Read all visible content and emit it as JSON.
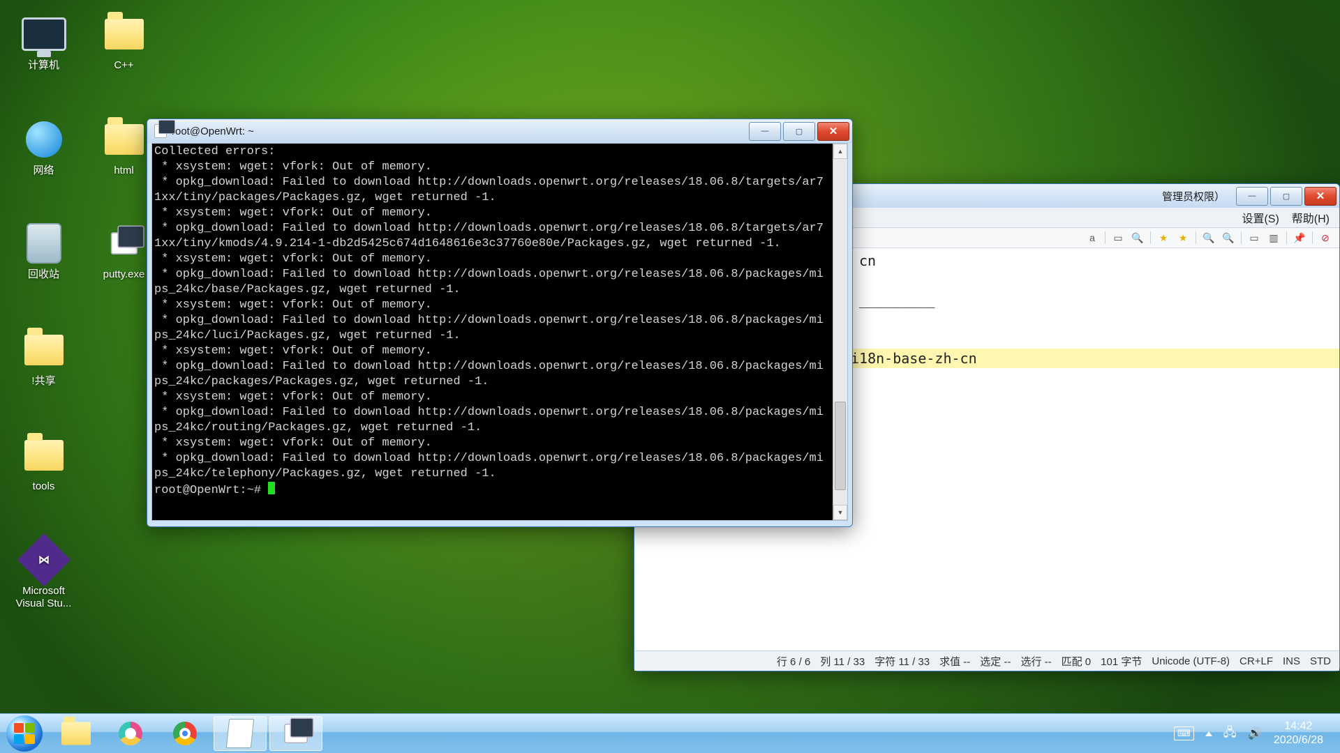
{
  "desktop_icons": {
    "computer": "计算机",
    "cpp": "C++",
    "network": "网络",
    "html": "html",
    "recycle": "回收站",
    "puttyexe": "putty.exe",
    "share": "!共享",
    "tools": "tools",
    "vs": "Microsoft Visual Stu..."
  },
  "putty": {
    "title": "root@OpenWrt: ~",
    "lines": [
      "Collected errors:",
      " * xsystem: wget: vfork: Out of memory.",
      " * opkg_download: Failed to download http://downloads.openwrt.org/releases/18.06.8/targets/ar71xx/tiny/packages/Packages.gz, wget returned -1.",
      " * xsystem: wget: vfork: Out of memory.",
      " * opkg_download: Failed to download http://downloads.openwrt.org/releases/18.06.8/targets/ar71xx/tiny/kmods/4.9.214-1-db2d5425c674d1648616e3c37760e80e/Packages.gz, wget returned -1.",
      " * xsystem: wget: vfork: Out of memory.",
      " * opkg_download: Failed to download http://downloads.openwrt.org/releases/18.06.8/packages/mips_24kc/base/Packages.gz, wget returned -1.",
      " * xsystem: wget: vfork: Out of memory.",
      " * opkg_download: Failed to download http://downloads.openwrt.org/releases/18.06.8/packages/mips_24kc/luci/Packages.gz, wget returned -1.",
      " * xsystem: wget: vfork: Out of memory.",
      " * opkg_download: Failed to download http://downloads.openwrt.org/releases/18.06.8/packages/mips_24kc/packages/Packages.gz, wget returned -1.",
      " * xsystem: wget: vfork: Out of memory.",
      " * opkg_download: Failed to download http://downloads.openwrt.org/releases/18.06.8/packages/mips_24kc/routing/Packages.gz, wget returned -1.",
      " * xsystem: wget: vfork: Out of memory.",
      " * opkg_download: Failed to download http://downloads.openwrt.org/releases/18.06.8/packages/mips_24kc/telephony/Packages.gz, wget returned -1."
    ],
    "prompt": "root@OpenWrt:~# "
  },
  "editor": {
    "title_fragment": "管理员权限）",
    "menu": {
      "settings": "设置(S)",
      "help": "帮助(H)"
    },
    "visible_line1_tail": "cn",
    "visible_divider": "_________",
    "highlight_tail": "i18n-base-zh-cn",
    "status": {
      "row": "行 6 / 6",
      "col": "列 11 / 33",
      "char": "字符 11 / 33",
      "sum": "求值 --",
      "sel": "选定 --",
      "lines": "选行 --",
      "match": "匹配 0",
      "bytes": "101 字节",
      "encoding": "Unicode (UTF-8)",
      "eol": "CR+LF",
      "ins": "INS",
      "std": "STD"
    }
  },
  "tray": {
    "time": "14:42",
    "date": "2020/6/28"
  }
}
